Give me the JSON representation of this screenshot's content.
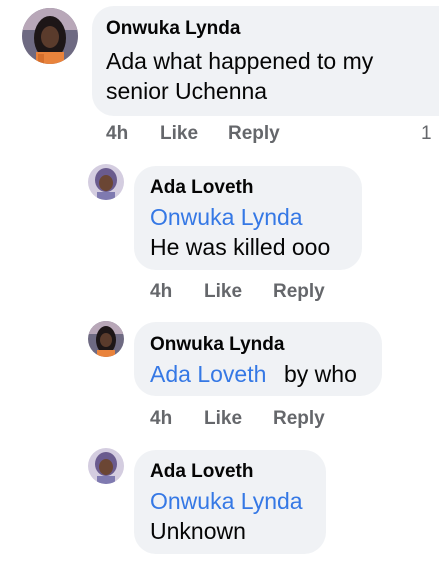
{
  "comments": [
    {
      "author": "Onwuka Lynda",
      "line1": "Ada what happened to my",
      "line2": "senior Uchenna",
      "time": "4h",
      "like": "Like",
      "reply": "Reply",
      "reaction_count": "1"
    },
    {
      "author": "Ada Loveth",
      "mention": "Onwuka Lynda",
      "text": "He was killed ooo",
      "time": "4h",
      "like": "Like",
      "reply": "Reply"
    },
    {
      "author": "Onwuka Lynda",
      "mention": "Ada Loveth",
      "text": "by who",
      "time": "4h",
      "like": "Like",
      "reply": "Reply"
    },
    {
      "author": "Ada Loveth",
      "mention": "Onwuka Lynda",
      "text": "Unknown"
    }
  ],
  "colors": {
    "bubble": "#f0f2f5",
    "mention": "#3578e5",
    "meta": "#65676b",
    "text": "#050505"
  }
}
